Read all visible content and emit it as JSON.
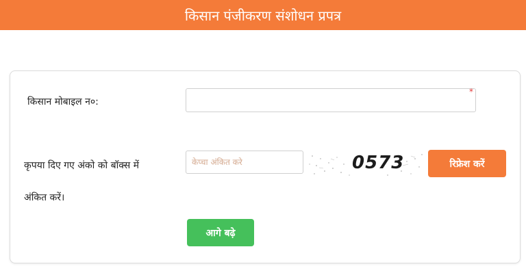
{
  "header": {
    "title": "किसान पंजीकरण संशोधन प्रपत्र"
  },
  "form": {
    "mobile_label": "किसान मोबाइल न०:",
    "mobile_value": "",
    "required_mark": "*",
    "captcha_label_line1": "कृपया दिए गए अंको को बॉक्स में",
    "captcha_label_line2": "अंकित करें।",
    "captcha_placeholder": "केप्चा अंकित करे",
    "captcha_value": "",
    "captcha_code": "0573",
    "refresh_label": "रिफ्रेश करें",
    "next_label": "आगे बढ़े"
  },
  "colors": {
    "header_bg": "#f47b39",
    "refresh_bg": "#f47b39",
    "next_bg": "#45c05b",
    "required": "#e23b3b"
  }
}
